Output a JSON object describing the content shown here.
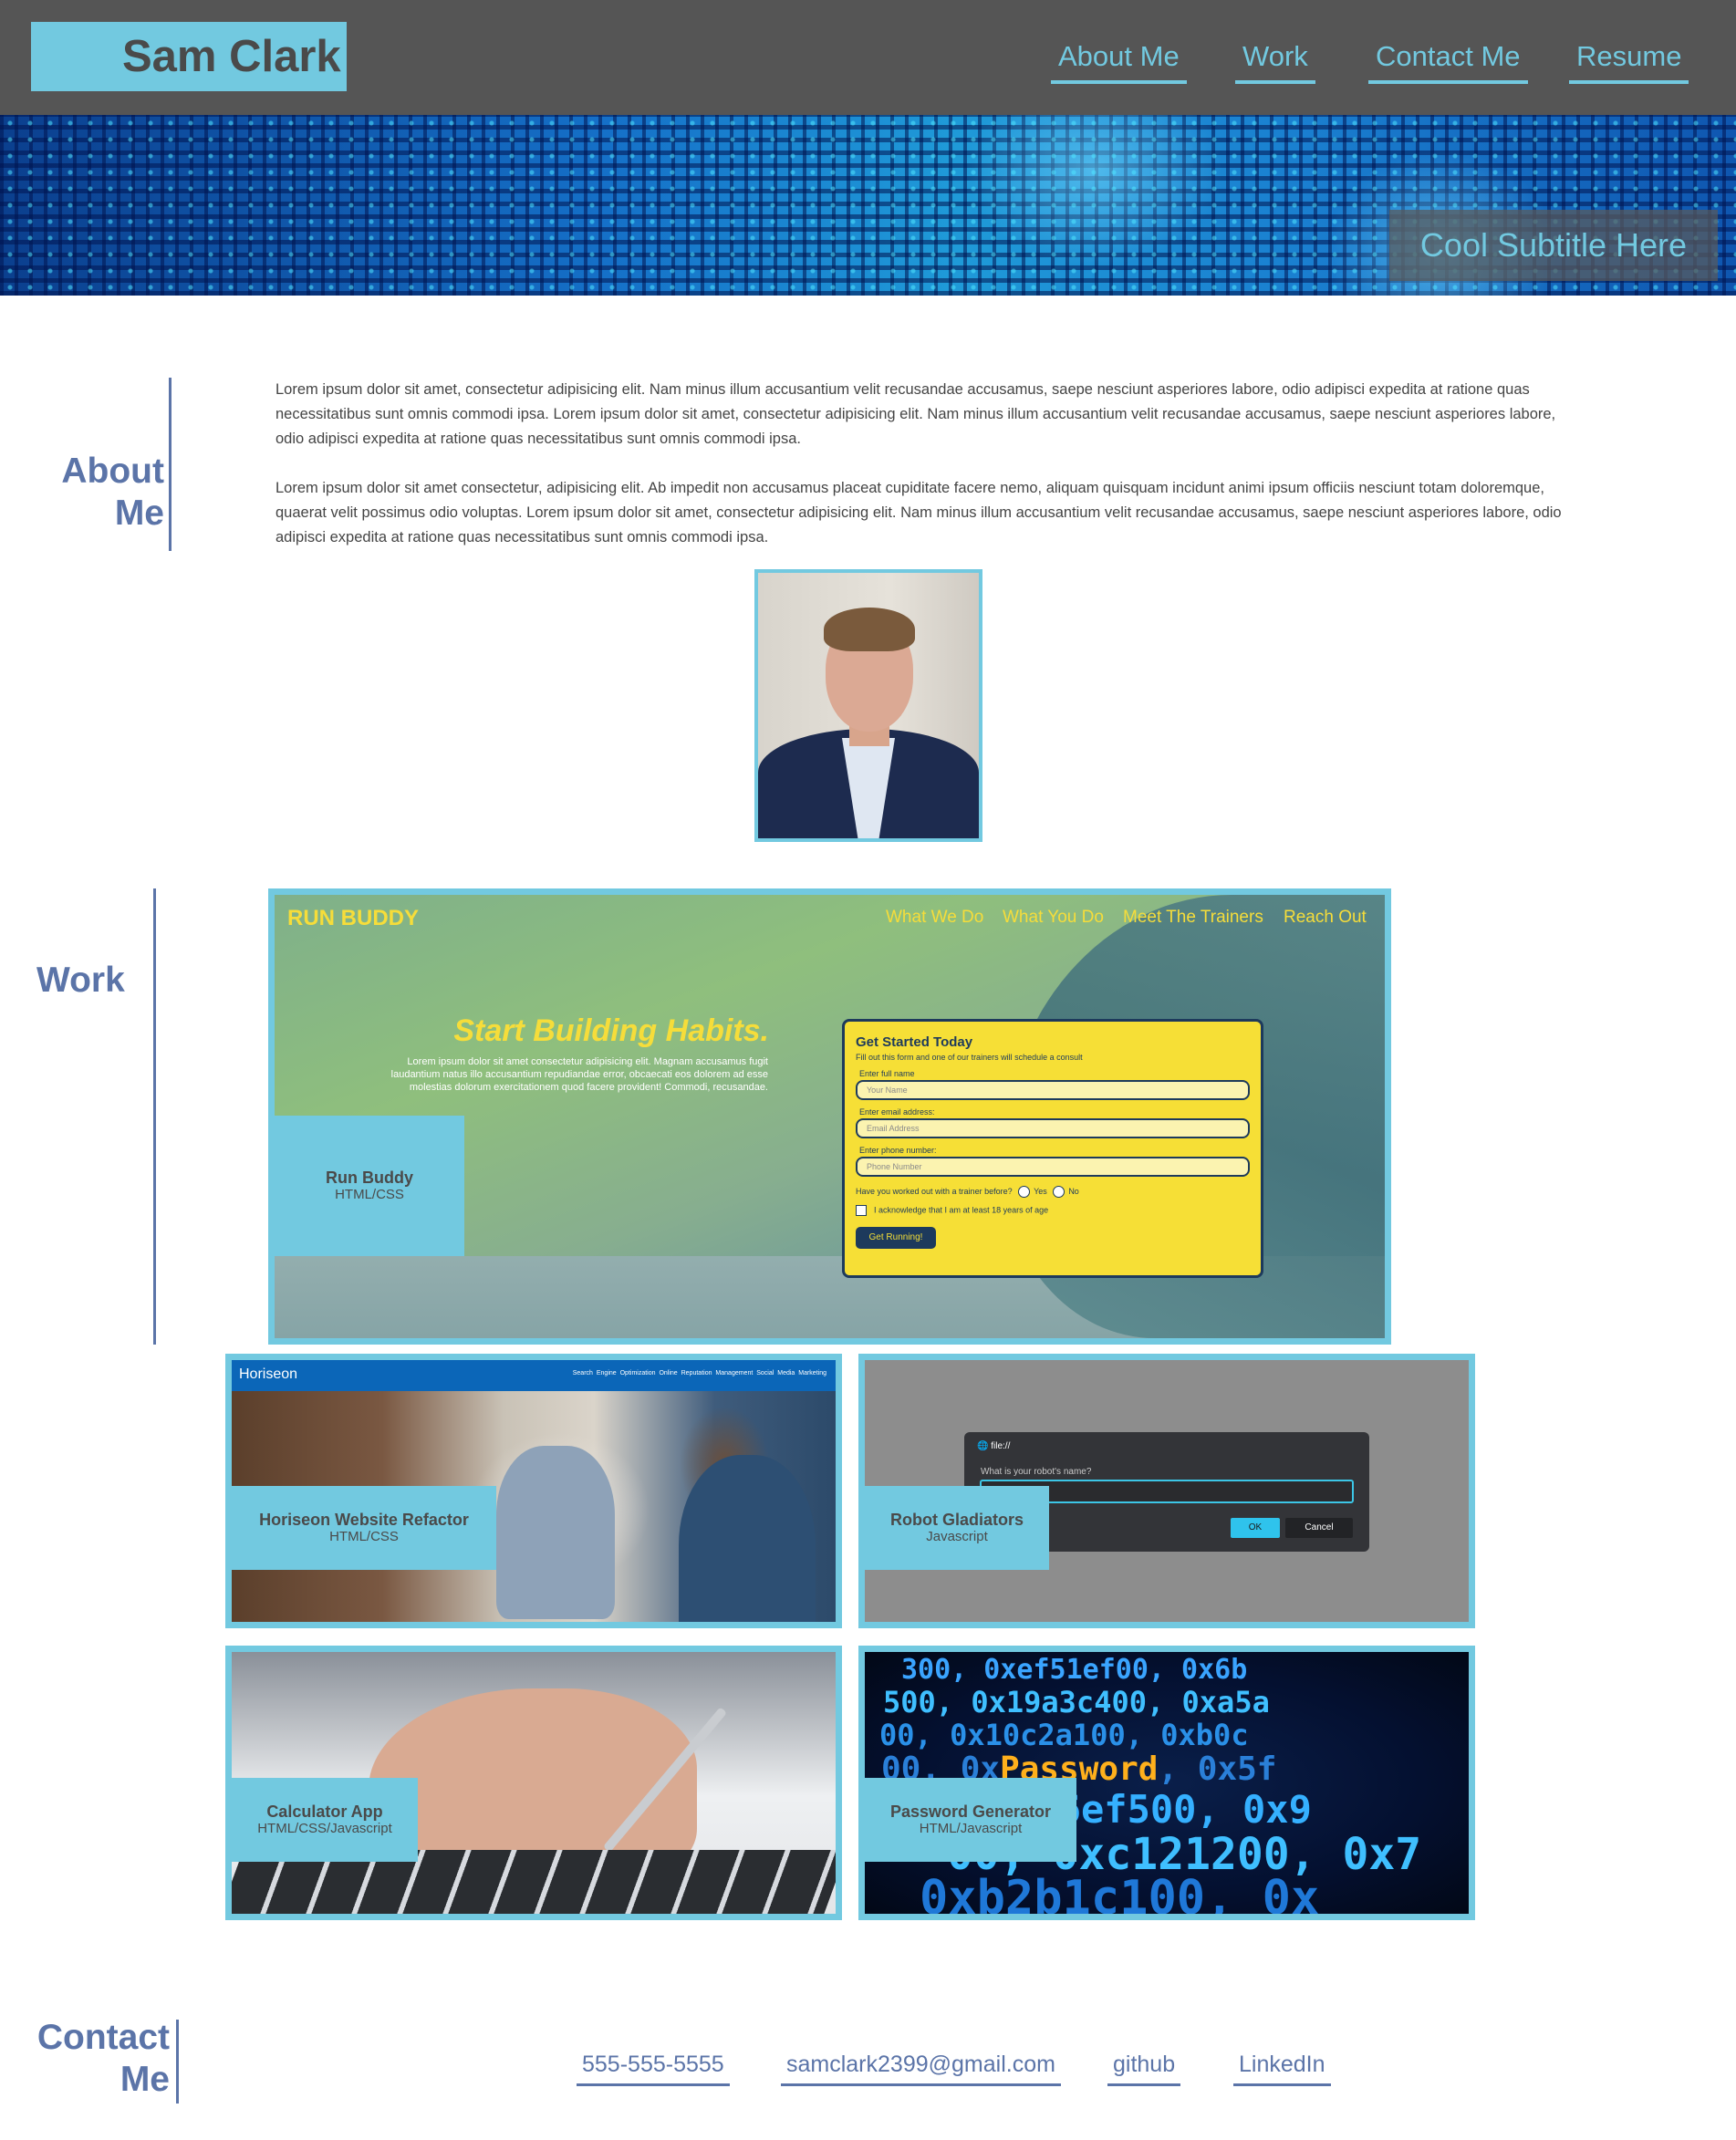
{
  "header": {
    "brand": "Sam Clark",
    "nav": [
      {
        "label": "About Me"
      },
      {
        "label": "Work"
      },
      {
        "label": "Contact Me"
      },
      {
        "label": "Resume"
      }
    ]
  },
  "hero": {
    "subtitle": "Cool Subtitle Here"
  },
  "about": {
    "heading_line1": "About",
    "heading_line2": "Me",
    "paragraphs": [
      "Lorem ipsum dolor sit amet, consectetur adipisicing elit. Nam minus illum accusantium velit recusandae accusamus, saepe nesciunt asperiores labore, odio adipisci expedita at ratione quas necessitatibus sunt omnis commodi ipsa. Lorem ipsum dolor sit amet, consectetur adipisicing elit. Nam minus illum accusantium velit recusandae accusamus, saepe nesciunt asperiores labore, odio adipisci expedita at ratione quas necessitatibus sunt omnis commodi ipsa.",
      "Lorem ipsum dolor sit amet consectetur, adipisicing elit. Ab impedit non accusamus placeat cupiditate facere nemo, aliquam quisquam incidunt animi ipsum officiis nesciunt totam doloremque, quaerat velit possimus odio voluptas. Lorem ipsum dolor sit amet, consectetur adipisicing elit. Nam minus illum accusantium velit recusandae accusamus, saepe nesciunt asperiores labore, odio adipisci expedita at ratione quas necessitatibus sunt omnis commodi ipsa."
    ]
  },
  "work": {
    "heading": "Work",
    "projects": [
      {
        "title": "Run Buddy",
        "tech": "HTML/CSS"
      },
      {
        "title": "Horiseon Website Refactor",
        "tech": "HTML/CSS"
      },
      {
        "title": "Robot Gladiators",
        "tech": "Javascript"
      },
      {
        "title": "Calculator App",
        "tech": "HTML/CSS/Javascript"
      },
      {
        "title": "Password Generator",
        "tech": "HTML/Javascript"
      }
    ],
    "run_buddy_preview": {
      "logo": "RUN BUDDY",
      "nav": [
        "What We Do",
        "What You Do",
        "Meet The Trainers",
        "Reach Out"
      ],
      "hero_title": "Start Building Habits.",
      "hero_text": "Lorem ipsum dolor sit amet consectetur adipisicing elit. Magnam accusamus fugit laudantium natus illo accusantium repudiandae error, obcaecati eos dolorem ad esse molestias dolorum exercitationem quod facere provident! Commodi, recusandae.",
      "form_title": "Get Started Today",
      "form_desc": "Fill out this form and one of our trainers will schedule a consult",
      "name_label": "Enter full name",
      "name_placeholder": "Your Name",
      "email_label": "Enter email address:",
      "email_placeholder": "Email Address",
      "phone_label": "Enter phone number:",
      "phone_placeholder": "Phone Number",
      "question": "Have you worked out with a trainer before?",
      "yes": "Yes",
      "no": "No",
      "acknowledge": "I acknowledge that I am at least 18 years of age",
      "button": "Get Running!"
    },
    "horiseon_preview": {
      "logo": "Horiseon",
      "nav": "Search Engine Optimization   Online Reputation Management   Social Media Marketing"
    },
    "robot_preview": {
      "file": "file://",
      "question": "What is your robot's name?",
      "ok": "OK",
      "cancel": "Cancel"
    },
    "password_preview": {
      "lines": [
        "300, 0xef51ef00, 0x6b",
        "500, 0x19a3c400, 0xa5a",
        "00, 0x10c2a100, 0xb0c",
        "00, 0xPassword, 0x5f",
        "0x0x556ef500, 0x9",
        "00, 0xc121200, 0x7",
        "0xb2b1c100, 0x"
      ],
      "highlight": "Password"
    }
  },
  "contact": {
    "heading_line1": "Contact",
    "heading_line2": "Me",
    "links": [
      {
        "label": "555-555-5555"
      },
      {
        "label": "samclark2399@gmail.com"
      },
      {
        "label": "github"
      },
      {
        "label": "LinkedIn"
      }
    ]
  },
  "colors": {
    "accent": "#72c9e0",
    "header_bg": "#555555",
    "heading_blue": "#5b74a8",
    "runbuddy_yellow": "#f6df36"
  }
}
